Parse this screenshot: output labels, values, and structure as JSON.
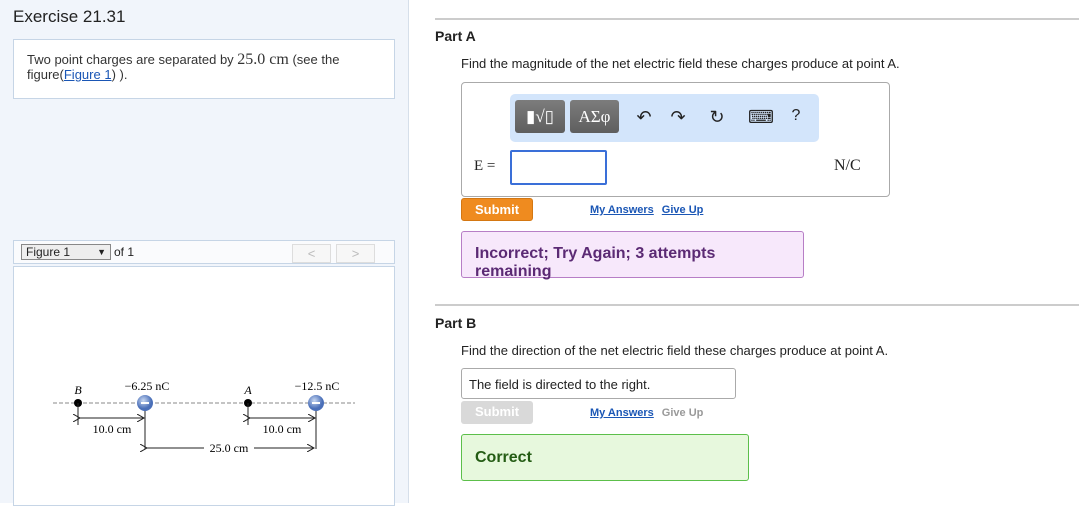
{
  "exercise_title": "Exercise 21.31",
  "problem": {
    "text_before": "Two point charges are separated by ",
    "distance": "25.0 cm",
    "text_mid": " (see the figure(",
    "link": "Figure 1",
    "text_after": ") )."
  },
  "figure_nav": {
    "selected": "Figure 1",
    "of_label": "of 1",
    "prev": "<",
    "next": ">"
  },
  "figure": {
    "point_b": "B",
    "point_a": "A",
    "charge1": "−6.25 nC",
    "charge2": "−12.5 nC",
    "dist1": "10.0 cm",
    "dist2": "10.0 cm",
    "dist_total": "25.0 cm",
    "charge_sign": "−"
  },
  "part_a": {
    "heading": "Part A",
    "question": "Find the magnitude of the net electric field these charges produce at point A.",
    "toolbar": {
      "templates": "▮√▯",
      "greek": "ΑΣφ",
      "undo": "↶",
      "redo": "↷",
      "reset": "↻",
      "keyboard": "⌨",
      "help": "?"
    },
    "var_label": "E =",
    "value": "",
    "unit": "N/C",
    "submit": "Submit",
    "my_answers": "My Answers",
    "give_up": "Give Up",
    "feedback": "Incorrect; Try Again; 3 attempts remaining"
  },
  "part_b": {
    "heading": "Part B",
    "question": "Find the direction of the net electric field these charges produce at point A.",
    "selected": "The field is directed to the right.",
    "submit": "Submit",
    "my_answers": "My Answers",
    "give_up": "Give Up",
    "feedback": "Correct"
  },
  "colors": {
    "submit_active": "#ef8b1f",
    "submit_disabled": "#d9d9d9",
    "charge": "#5a80c8"
  }
}
